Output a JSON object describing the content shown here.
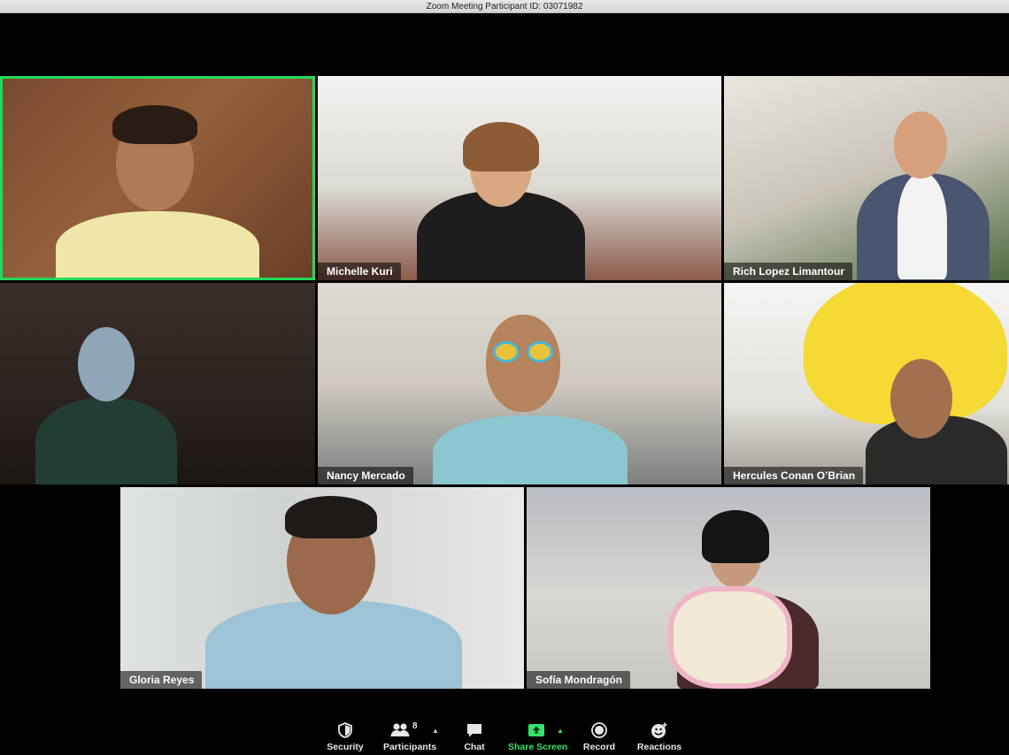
{
  "window": {
    "title": "Zoom Meeting Participant ID: 03071982"
  },
  "participants": [
    {
      "name": "",
      "active": true
    },
    {
      "name": "Michelle Kuri"
    },
    {
      "name": "Rich Lopez Limantour"
    },
    {
      "name": ""
    },
    {
      "name": "Nancy Mercado"
    },
    {
      "name": "Hercules Conan O’Brian"
    },
    {
      "name": "Gloria Reyes"
    },
    {
      "name": "Sofía Mondragón"
    }
  ],
  "toolbar": {
    "security": {
      "label": "Security",
      "icon": "shield-icon"
    },
    "participants": {
      "label": "Participants",
      "count": "8",
      "icon": "people-icon"
    },
    "chat": {
      "label": "Chat",
      "icon": "chat-bubble-icon"
    },
    "share": {
      "label": "Share Screen",
      "icon": "share-arrow-icon"
    },
    "record": {
      "label": "Record",
      "icon": "record-icon"
    },
    "reactions": {
      "label": "Reactions",
      "icon": "smiley-icon"
    }
  },
  "colors": {
    "active_speaker": "#23d959",
    "share_green": "#35e36a"
  }
}
